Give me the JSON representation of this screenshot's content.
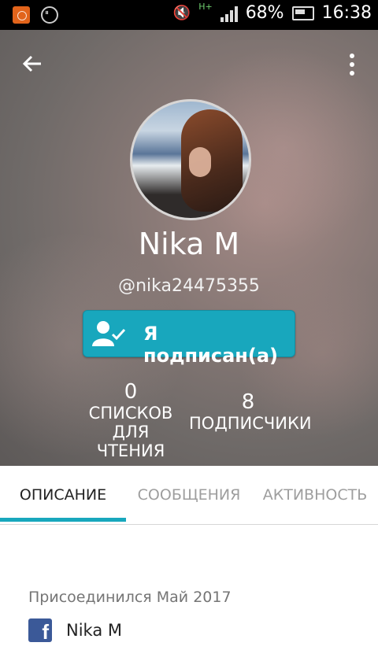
{
  "status_bar": {
    "battery": "68%",
    "time": "16:38",
    "network": "H+"
  },
  "profile": {
    "name": "Nika M",
    "handle": "@nika24475355",
    "follow_button": "Я подписан(а)"
  },
  "stats": [
    {
      "value": "0",
      "label_line1": "СПИСКОВ ДЛЯ",
      "label_line2": "ЧТЕНИЯ"
    },
    {
      "value": "8",
      "label_line1": "ПОДПИСЧИКИ"
    }
  ],
  "tabs": [
    {
      "label": "ОПИСАНИЕ",
      "active": true
    },
    {
      "label": "СООБЩЕНИЯ",
      "active": false
    },
    {
      "label": "АКТИВНОСТЬ",
      "active": false
    }
  ],
  "about": {
    "joined": "Присоединился Май 2017",
    "facebook_name": "Nika M"
  },
  "colors": {
    "accent": "#18a7bd",
    "facebook": "#3b5998"
  }
}
